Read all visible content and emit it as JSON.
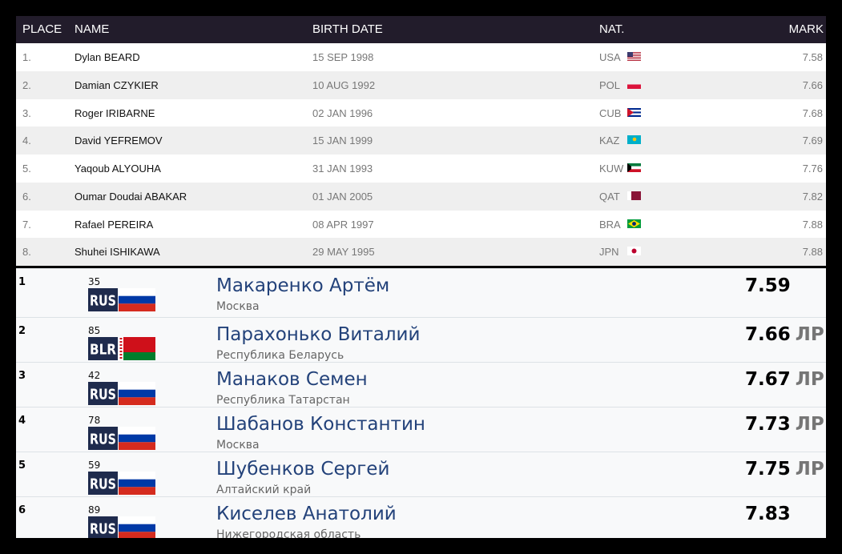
{
  "table": {
    "headers": {
      "place": "PLACE",
      "name": "NAME",
      "birth_date": "BIRTH DATE",
      "nat": "NAT.",
      "mark": "MARK"
    },
    "rows": [
      {
        "place": "1.",
        "name": "Dylan BEARD",
        "birth_date": "15 SEP 1998",
        "nat": "USA",
        "flag_icon": "usa-flag-icon",
        "mark": "7.58"
      },
      {
        "place": "2.",
        "name": "Damian CZYKIER",
        "birth_date": "10 AUG 1992",
        "nat": "POL",
        "flag_icon": "pol-flag-icon",
        "mark": "7.66"
      },
      {
        "place": "3.",
        "name": "Roger IRIBARNE",
        "birth_date": "02 JAN 1996",
        "nat": "CUB",
        "flag_icon": "cub-flag-icon",
        "mark": "7.68"
      },
      {
        "place": "4.",
        "name": "David YEFREMOV",
        "birth_date": "15 JAN 1999",
        "nat": "KAZ",
        "flag_icon": "kaz-flag-icon",
        "mark": "7.69"
      },
      {
        "place": "5.",
        "name": "Yaqoub ALYOUHA",
        "birth_date": "31 JAN 1993",
        "nat": "KUW",
        "flag_icon": "kuw-flag-icon",
        "mark": "7.76"
      },
      {
        "place": "6.",
        "name": "Oumar Doudai ABAKAR",
        "birth_date": "01 JAN 2005",
        "nat": "QAT",
        "flag_icon": "qat-flag-icon",
        "mark": "7.82"
      },
      {
        "place": "7.",
        "name": "Rafael PEREIRA",
        "birth_date": "08 APR 1997",
        "nat": "BRA",
        "flag_icon": "bra-flag-icon",
        "mark": "7.88"
      },
      {
        "place": "8.",
        "name": "Shuhei ISHIKAWA",
        "birth_date": "29 MAY 1995",
        "nat": "JPN",
        "flag_icon": "jpn-flag-icon",
        "mark": "7.88"
      }
    ]
  },
  "results": [
    {
      "position": "1",
      "lane": "35",
      "country": "RUS",
      "flag_icon": "rus-flag-icon",
      "name": "Макаренко Артём",
      "region": "Москва",
      "result": "7.59",
      "note": ""
    },
    {
      "position": "2",
      "lane": "85",
      "country": "BLR",
      "flag_icon": "blr-flag-icon",
      "name": "Парахонько Виталий",
      "region": "Республика Беларусь",
      "result": "7.66",
      "note": "ЛР"
    },
    {
      "position": "3",
      "lane": "42",
      "country": "RUS",
      "flag_icon": "rus-flag-icon",
      "name": "Манаков Семен",
      "region": "Республика Татарстан",
      "result": "7.67",
      "note": "ЛР"
    },
    {
      "position": "4",
      "lane": "78",
      "country": "RUS",
      "flag_icon": "rus-flag-icon",
      "name": "Шабанов Константин",
      "region": "Москва",
      "result": "7.73",
      "note": "ЛР"
    },
    {
      "position": "5",
      "lane": "59",
      "country": "RUS",
      "flag_icon": "rus-flag-icon",
      "name": "Шубенков Сергей",
      "region": "Алтайский край",
      "result": "7.75",
      "note": "ЛР"
    },
    {
      "position": "6",
      "lane": "89",
      "country": "RUS",
      "flag_icon": "rus-flag-icon",
      "name": "Киселев Анатолий",
      "region": "Нижегородская область",
      "result": "7.83",
      "note": ""
    }
  ],
  "colors": {
    "header_bg": "#221c2b",
    "header_text": "#ffffff",
    "row_alt_bg": "#efefef",
    "athlete_name": "#23427a",
    "flag_code_box": "#1f2b4d"
  }
}
